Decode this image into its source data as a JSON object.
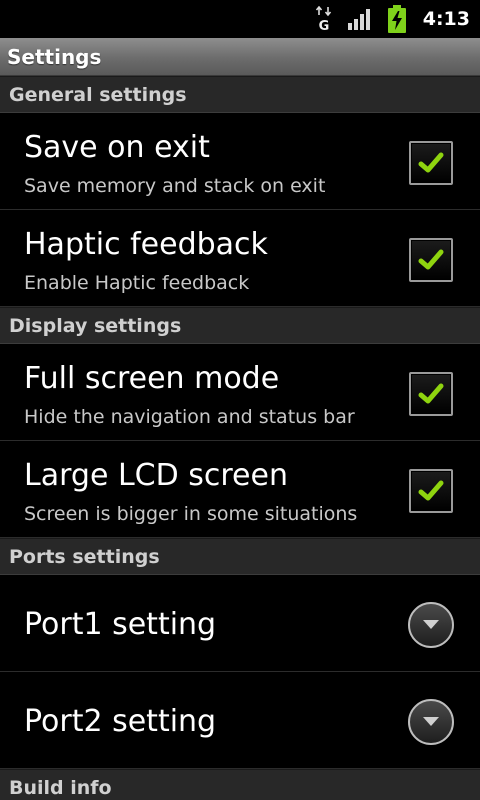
{
  "status_bar": {
    "network_type": "G",
    "time": "4:13"
  },
  "title_bar": {
    "title": "Settings"
  },
  "sections": [
    {
      "header": "General settings",
      "items": [
        {
          "title": "Save on exit",
          "summary": "Save memory and stack on exit",
          "checked": true
        },
        {
          "title": "Haptic feedback",
          "summary": "Enable Haptic feedback",
          "checked": true
        }
      ]
    },
    {
      "header": "Display settings",
      "items": [
        {
          "title": "Full screen mode",
          "summary": "Hide the navigation and status bar",
          "checked": true
        },
        {
          "title": "Large LCD screen",
          "summary": "Screen is bigger in some situations",
          "checked": true
        }
      ]
    },
    {
      "header": "Ports settings",
      "items": [
        {
          "title": "Port1 setting"
        },
        {
          "title": "Port2 setting"
        }
      ]
    },
    {
      "header": "Build info"
    }
  ],
  "icons": {
    "network": "network-arrows-icon",
    "signal": "signal-strength-icon",
    "battery": "battery-charging-icon",
    "checkmark": "checkmark-icon",
    "dropdown": "chevron-down-icon"
  },
  "colors": {
    "check_green": "#8fd40f",
    "battery_green": "#7fd11b",
    "title_bar": "#7a7a7a",
    "category_bg": "#282828"
  }
}
